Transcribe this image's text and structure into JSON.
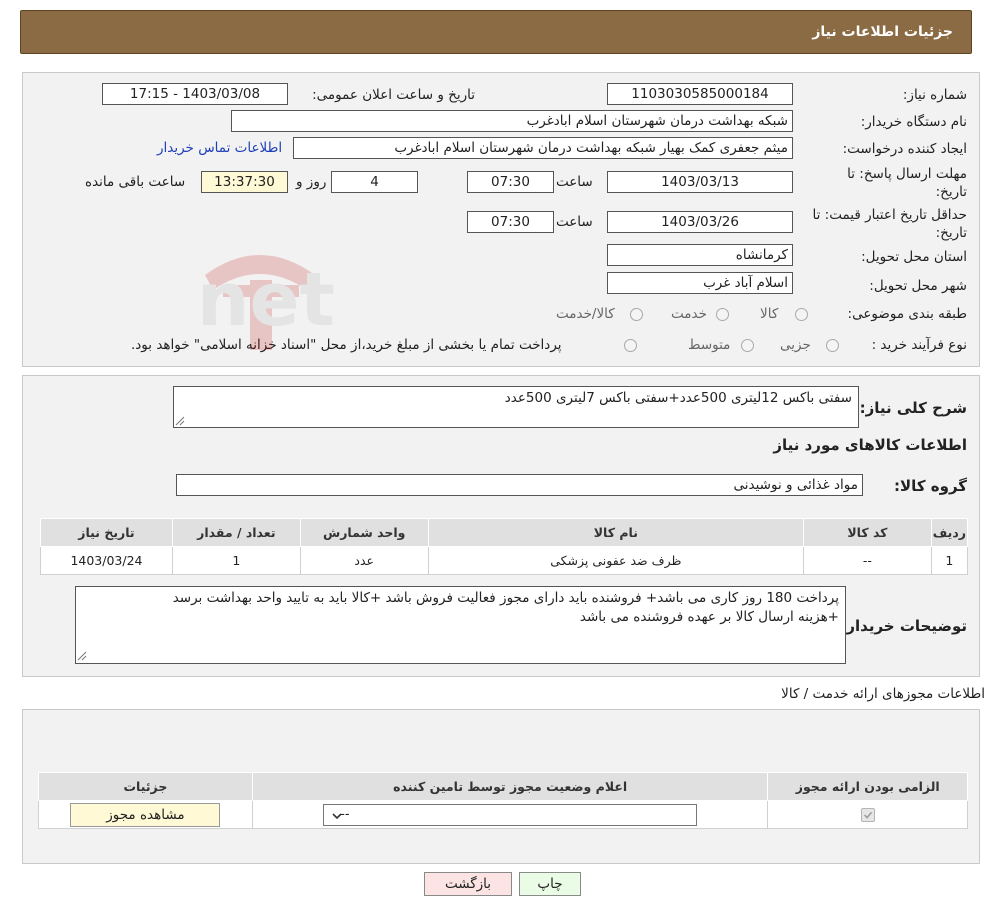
{
  "header": {
    "title": "جزئیات اطلاعات نیاز"
  },
  "form": {
    "need_number_label": "شماره نیاز:",
    "need_number": "1103030585000184",
    "announce_label": "تاریخ و ساعت اعلان عمومی:",
    "announce_value": "1403/03/08 - 17:15",
    "buyer_org_label": "نام دستگاه خریدار:",
    "buyer_org": "شبکه بهداشت درمان شهرستان اسلام ابادغرب",
    "requester_label": "ایجاد کننده درخواست:",
    "requester": "میثم جعفری کمک بهیار شبکه بهداشت درمان شهرستان اسلام ابادغرب",
    "contact_link": "اطلاعات تماس خریدار",
    "deadline_label_1": "مهلت ارسال پاسخ: تا",
    "deadline_label_2": "تاریخ:",
    "deadline_date": "1403/03/13",
    "time_label": "ساعت",
    "deadline_time": "07:30",
    "days_value": "4",
    "days_label": "روز و",
    "remaining_time": "13:37:30",
    "remaining_label": "ساعت باقی مانده",
    "validity_label_1": "حداقل تاریخ اعتبار قیمت: تا",
    "validity_label_2": "تاریخ:",
    "validity_date": "1403/03/26",
    "validity_time": "07:30",
    "province_label": "استان محل تحویل:",
    "province": "کرمانشاه",
    "city_label": "شهر محل تحویل:",
    "city": "اسلام آباد غرب",
    "category_label": "طبقه بندی موضوعی:",
    "category_options": [
      "کالا",
      "خدمت",
      "کالا/خدمت"
    ],
    "purchase_type_label": "نوع فرآیند خرید :",
    "purchase_options": [
      "جزیی",
      "متوسط"
    ],
    "purchase_note": "پرداخت تمام یا بخشی از مبلغ خرید،از محل \"اسناد خزانه اسلامی\" خواهد بود."
  },
  "summary": {
    "label": "شرح کلی نیاز:",
    "value": "سفتی باکس 12لیتری 500عدد+سفتی باکس 7لیتری 500عدد",
    "goods_info_title": "اطلاعات کالاهای مورد نیاز",
    "group_label": "گروه کالا:",
    "group_value": "مواد غذائی و نوشیدنی"
  },
  "goods_table": {
    "headers": [
      "ردیف",
      "کد کالا",
      "نام کالا",
      "واحد شمارش",
      "تعداد / مقدار",
      "تاریخ نیاز"
    ],
    "rows": [
      [
        "1",
        "--",
        "ظرف ضد عفونی پزشکی",
        "عدد",
        "1",
        "1403/03/24"
      ]
    ]
  },
  "buyer_notes": {
    "label": "توضیحات خریدار:",
    "line1": "پرداخت 180 روز کاری می باشد+ فروشنده باید دارای مجوز فعالیت فروش باشد +کالا باید به تایید واحد بهداشت  برسد",
    "line2": "+هزینه ارسال کالا بر عهده فروشنده می باشد"
  },
  "licenses": {
    "title": "اطلاعات مجوزهای ارائه خدمت / کالا",
    "headers": [
      "الزامی بودن ارائه مجوز",
      "اعلام وضعیت مجوز توسط تامین کننده",
      "جزئیات"
    ],
    "select_value": "--",
    "view_button": "مشاهده مجوز"
  },
  "buttons": {
    "print": "چاپ",
    "back": "بازگشت"
  },
  "watermark": {
    "text": "AriaTender.net"
  }
}
